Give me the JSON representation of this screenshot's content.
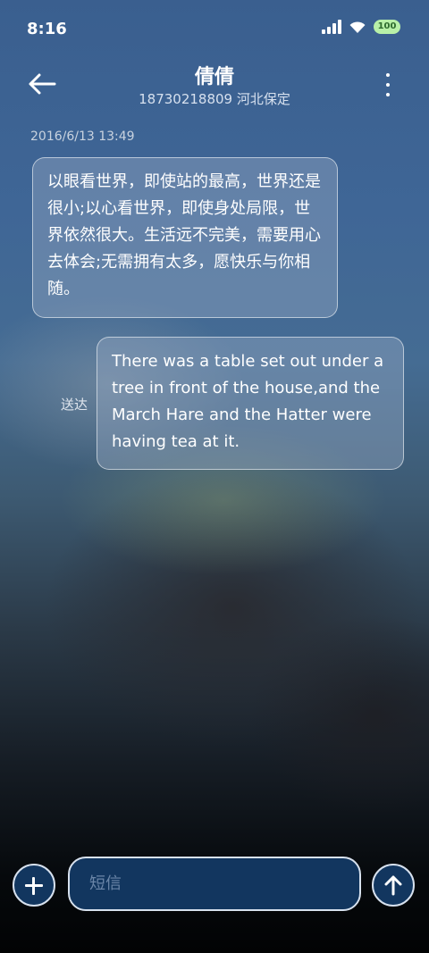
{
  "status_bar": {
    "time": "8:16",
    "battery": "100",
    "icons": [
      "signal-icon",
      "wifi-icon",
      "battery-icon"
    ]
  },
  "header": {
    "contact_name": "倩倩",
    "contact_info": "18730218809 河北保定",
    "back_icon": "arrow-left-icon",
    "menu_icon": "more-vertical-icon"
  },
  "conversation": {
    "timestamp": "2016/6/13 13:49",
    "messages": [
      {
        "direction": "incoming",
        "text": "以眼看世界，即使站的最高，世界还是很小;以心看世界，即使身处局限，世界依然很大。生活远不完美，需要用心去体会;无需拥有太多，愿快乐与你相随。"
      },
      {
        "direction": "outgoing",
        "status": "送达",
        "text": "There was a table set out under a tree in front of the house,and the March Hare and the Hatter were having tea at it."
      }
    ]
  },
  "composer": {
    "placeholder": "短信",
    "value": "",
    "add_icon": "plus-icon",
    "send_icon": "arrow-up-icon"
  },
  "colors": {
    "button_bg": "#12365f",
    "button_border": "#d7e1ee",
    "bubble_bg": "rgba(150,170,195,0.42)"
  }
}
